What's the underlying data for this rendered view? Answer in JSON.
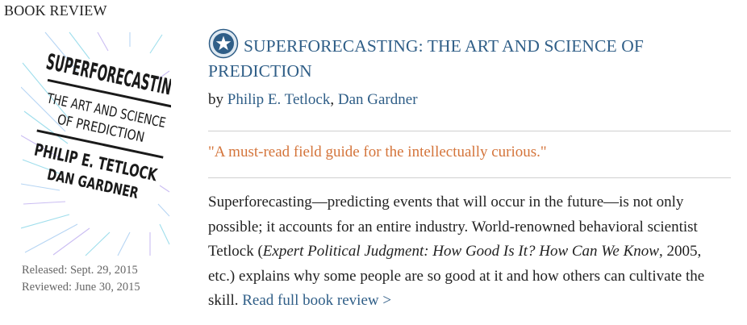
{
  "section": {
    "label": "BOOK REVIEW"
  },
  "book": {
    "title": "SUPERFORECASTING: THE ART AND SCIENCE OF PREDICTION",
    "by_prefix": "by ",
    "authors": [
      "Philip E. Tetlock",
      "Dan Gardner"
    ],
    "author_separator": ", ",
    "released": "Released: Sept. 29, 2015",
    "reviewed": "Reviewed: June 30, 2015",
    "badge_icon": "star-badge-icon",
    "cover": {
      "line1": "SUPERFORECASTING",
      "line2": "THE ART AND SCIENCE",
      "line3": "OF PREDICTION",
      "line4": "PHILIP E. TETLOCK",
      "line5": "DAN GARDNER"
    }
  },
  "review": {
    "pull_quote": "\"A must-read field guide for the intellectually curious.\"",
    "desc_part1": "Superforecasting—predicting events that will occur in the future—is not only possible; it accounts for an entire industry. World-renowned behavioral scientist Tetlock (",
    "desc_italic": "Expert Political Judgment: How Good Is It? How Can We Know",
    "desc_part2": ", 2005, etc.) explains why some people are so good at it and how others can cultivate the skill. ",
    "read_more": "Read full book review >"
  },
  "colors": {
    "link": "#2f5e87",
    "quote": "#d4743a",
    "rule": "#cfcfcf",
    "meta": "#666666"
  }
}
